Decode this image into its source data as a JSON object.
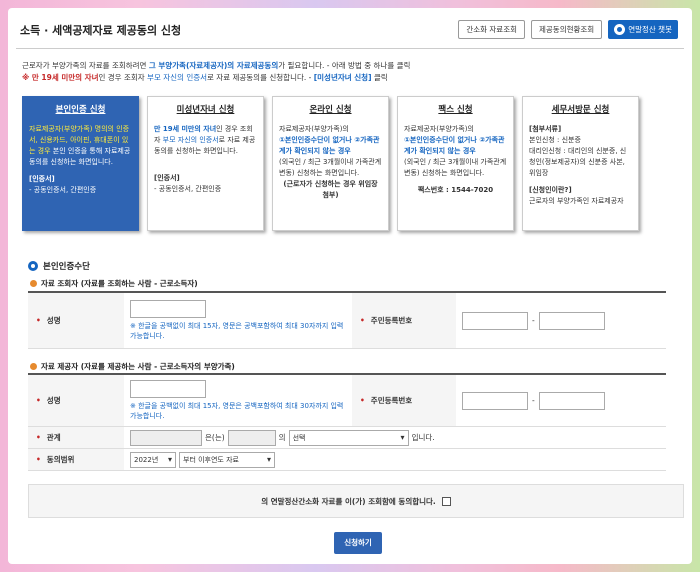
{
  "header": {
    "title": "소득 · 세액공제자료 제공동의 신청",
    "btn_simple_lookup": "간소화 자료조회",
    "btn_status_lookup": "제공동의현황조회",
    "btn_chatbot": "연말정산 챗봇"
  },
  "intro": {
    "line1_a": "근로자가 부양가족의 자료를 조회하려면 ",
    "line1_b": "그 부양가족(자료제공자)의 자료제공동의",
    "line1_c": "가 필요합니다. - 아래 방법 중 하나를 클릭",
    "line2_a": "※ 만 19세 미만의 자녀",
    "line2_b": "인 경우 조회자 ",
    "line2_c": "부모 자신의 인증서",
    "line2_d": "로 자료 제공동의를 신청합니다. - ",
    "line2_e": "[미성년자녀 신청]",
    "line2_f": " 클릭"
  },
  "cards": [
    {
      "title": "본인인증 신청",
      "body_a": "자료제공자(부양가족) 명의의 인증서, 신용카드, 아이핀, 휴대폰이 있는 경우",
      "body_b": " 본인 인증을 통해 자료제공동의를 신청하는 화면입니다.",
      "sub_title": "[인증서]",
      "sub_body": "- 공동인증서, 간편인증"
    },
    {
      "title": "미성년자녀 신청",
      "body_a": "만 19세 미만의 자녀",
      "body_b": "인 경우 조회자 ",
      "body_c": "부모 자신의 인증서",
      "body_d": "로 자료 제공 동의를 신청하는 화면입니다.",
      "sub_title": "[인증서]",
      "sub_body": "- 공동인증서, 간편인증"
    },
    {
      "title": "온라인 신청",
      "body_a": "자료제공자(부양가족)의",
      "body_b": "①본인인증수단이 없거나 ②가족관계가 확인되지 않는 경우",
      "body_c": "(외국인 / 최근 3개월이내 가족관계 변동) 신청하는 화면입니다.",
      "sub_body": "(근로자가 신청하는 경우 위임장 첨부)"
    },
    {
      "title": "팩스 신청",
      "body_a": "자료제공자(부양가족)의",
      "body_b": "①본인인증수단이 없거나 ②가족관계가 확인되지 않는 경우",
      "body_c": "(외국인 / 최근 3개월이내 가족관계 변동) 신청하는 화면입니다.",
      "sub_body": "팩스번호 : 1544-7020"
    },
    {
      "title": "세무서방문 신청",
      "sub_title": "[첨부서류]",
      "body_a": "본인신청 : 신분증",
      "body_b": "대리인신청 : 대리인의 신분증, 신청인(정보제공자)의 신분증 사본, 위임장",
      "sub_title2": "[신청인이란?]",
      "sub_body": "근로자의 부양가족인 자료제공자"
    }
  ],
  "section_title": "본인인증수단",
  "requester": {
    "heading": "자료 조회자 (자료를 조회하는 사람 - 근로소득자)",
    "name_label": "성명",
    "name_note": "※ 한글을 공백없이 최대 15자, 영문은 공백포함하여 최대 30자까지 입력가능합니다.",
    "rrn_label": "주민등록번호",
    "dash": "-"
  },
  "provider": {
    "heading": "자료 제공자 (자료를 제공하는 사람 - 근로소득자의 부양가족)",
    "name_label": "성명",
    "name_note": "※ 한글을 공백없이 최대 15자, 영문은 공백포함하여 최대 30자까지 입력가능합니다.",
    "rrn_label": "주민등록번호",
    "dash": "-",
    "relation_label": "관계",
    "relation_eun": "은(는)",
    "relation_ui": "의",
    "relation_select": "선택",
    "relation_end": "입니다.",
    "scope_label": "동의범위",
    "scope_year": "2022년",
    "scope_range": "부터 이후연도 자료"
  },
  "agree_text": "의 연말정산간소화 자료를 이(가) 조회함에 동의합니다.",
  "submit_label": "신청하기"
}
